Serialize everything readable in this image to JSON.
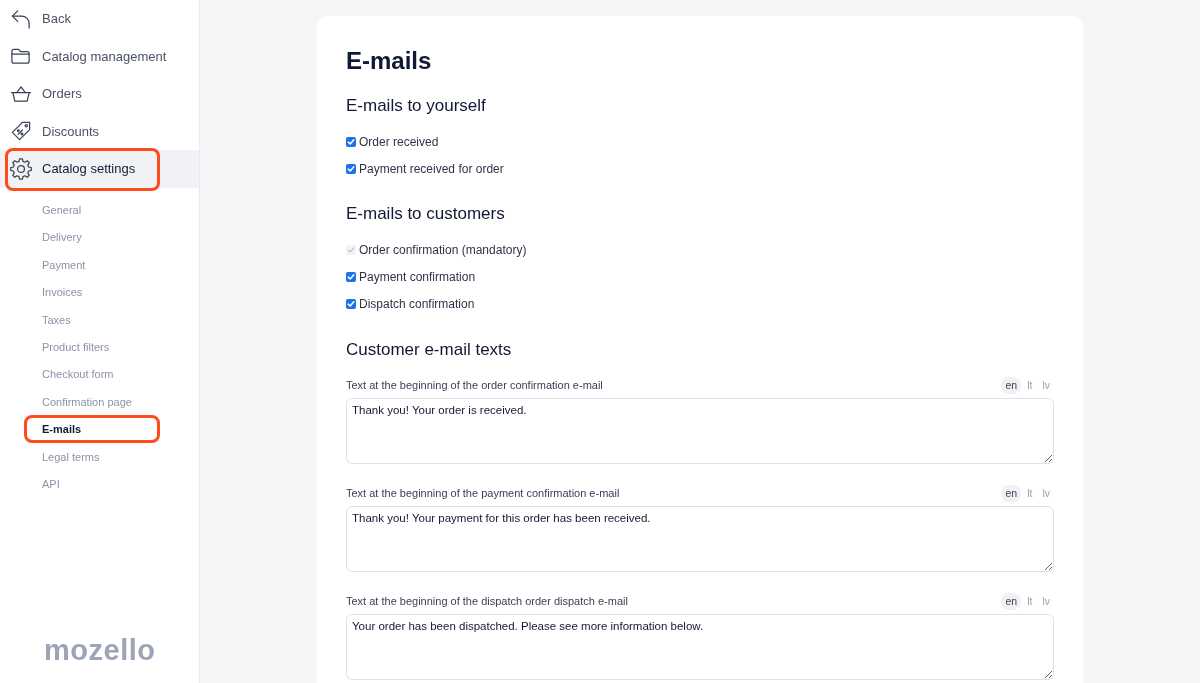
{
  "sidebar": {
    "items": [
      {
        "label": "Back",
        "kind": "back",
        "selected": false,
        "highlighted": false
      },
      {
        "label": "Catalog management",
        "kind": "folder",
        "selected": false,
        "highlighted": false
      },
      {
        "label": "Orders",
        "kind": "basket",
        "selected": false,
        "highlighted": false
      },
      {
        "label": "Discounts",
        "kind": "tag",
        "selected": false,
        "highlighted": false
      },
      {
        "label": "Catalog settings",
        "kind": "gear",
        "selected": true,
        "highlighted": true
      }
    ],
    "subitems": [
      {
        "label": "General",
        "selected": false,
        "highlighted": false
      },
      {
        "label": "Delivery",
        "selected": false,
        "highlighted": false
      },
      {
        "label": "Payment",
        "selected": false,
        "highlighted": false
      },
      {
        "label": "Invoices",
        "selected": false,
        "highlighted": false
      },
      {
        "label": "Taxes",
        "selected": false,
        "highlighted": false
      },
      {
        "label": "Product filters",
        "selected": false,
        "highlighted": false
      },
      {
        "label": "Checkout form",
        "selected": false,
        "highlighted": false
      },
      {
        "label": "Confirmation page",
        "selected": false,
        "highlighted": false
      },
      {
        "label": "E-mails",
        "selected": true,
        "highlighted": true
      },
      {
        "label": "Legal terms",
        "selected": false,
        "highlighted": false
      },
      {
        "label": "API",
        "selected": false,
        "highlighted": false
      }
    ],
    "logo": "mozello"
  },
  "page": {
    "title": "E-mails",
    "sections": [
      {
        "heading": "E-mails to yourself",
        "options": [
          {
            "label": "Order received",
            "checked": true,
            "disabled": false
          },
          {
            "label": "Payment received for order",
            "checked": true,
            "disabled": false
          }
        ]
      },
      {
        "heading": "E-mails to customers",
        "options": [
          {
            "label": "Order confirmation (mandatory)",
            "checked": true,
            "disabled": true
          },
          {
            "label": "Payment confirmation",
            "checked": true,
            "disabled": false
          },
          {
            "label": "Dispatch confirmation",
            "checked": true,
            "disabled": false
          }
        ]
      }
    ],
    "texts_heading": "Customer e-mail texts",
    "text_fields": [
      {
        "label": "Text at the beginning of the order confirmation e-mail",
        "value": "Thank you! Your order is received.",
        "languages": [
          {
            "label": "en",
            "selected": true
          },
          {
            "label": "lt",
            "selected": false
          },
          {
            "label": "lv",
            "selected": false
          }
        ]
      },
      {
        "label": "Text at the beginning of the payment confirmation e-mail",
        "value": "Thank you! Your payment for this order has been received.",
        "languages": [
          {
            "label": "en",
            "selected": true
          },
          {
            "label": "lt",
            "selected": false
          },
          {
            "label": "lv",
            "selected": false
          }
        ]
      },
      {
        "label": "Text at the beginning of the dispatch order dispatch e-mail",
        "value": "Your order has been dispatched. Please see more information below.",
        "languages": [
          {
            "label": "en",
            "selected": true
          },
          {
            "label": "lt",
            "selected": false
          },
          {
            "label": "lv",
            "selected": false
          }
        ]
      }
    ]
  }
}
